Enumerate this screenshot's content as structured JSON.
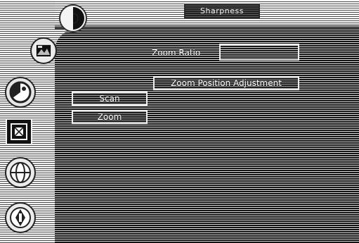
{
  "header": {
    "mode_label": "Sharpness"
  },
  "zoom_panel": {
    "ratio_label": "Zoom Ratio",
    "ratio_value": "",
    "position_button_label": "Zoom Position Adjustment",
    "scan_button_label": "Scan",
    "zoom_button_label": "Zoom"
  },
  "sidebar": {
    "icons": [
      "brightness-icon",
      "picture-icon",
      "color-icon",
      "zoom-icon",
      "globe-icon",
      "setup-icon"
    ]
  }
}
